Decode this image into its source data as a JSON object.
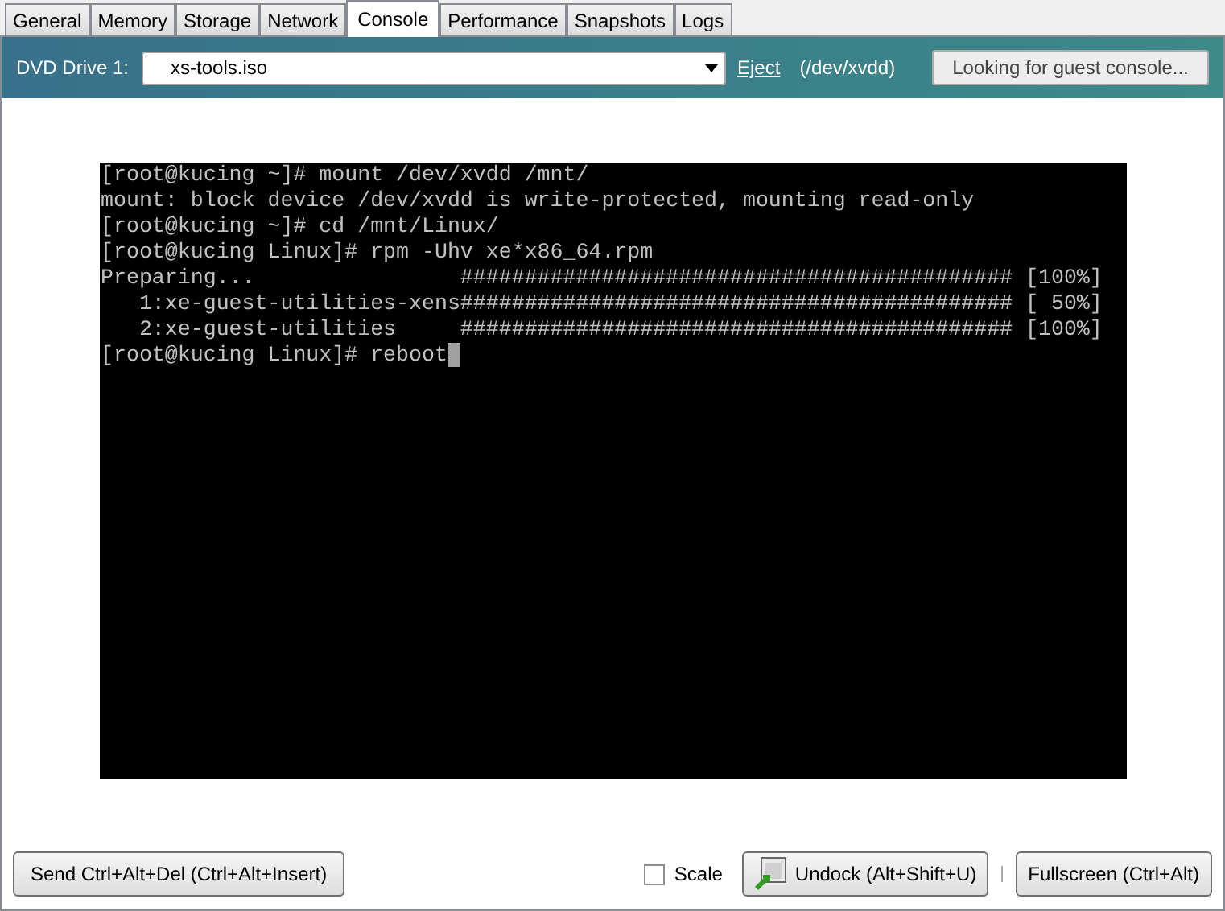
{
  "tabs": [
    {
      "label": "General",
      "selected": false
    },
    {
      "label": "Memory",
      "selected": false
    },
    {
      "label": "Storage",
      "selected": false
    },
    {
      "label": "Network",
      "selected": false
    },
    {
      "label": "Console",
      "selected": true
    },
    {
      "label": "Performance",
      "selected": false
    },
    {
      "label": "Snapshots",
      "selected": false
    },
    {
      "label": "Logs",
      "selected": false
    }
  ],
  "dvd_bar": {
    "label": "DVD Drive 1:",
    "drive_value": "xs-tools.iso",
    "eject_link": "Eject",
    "device_path": "(/dev/xvdd)",
    "console_button": "Looking for guest console..."
  },
  "terminal": {
    "lines": [
      "[root@kucing ~]# mount /dev/xvdd /mnt/",
      "mount: block device /dev/xvdd is write-protected, mounting read-only",
      "[root@kucing ~]# cd /mnt/Linux/",
      "[root@kucing Linux]# rpm -Uhv xe*x86_64.rpm",
      "Preparing...                ########################################### [100%]",
      "   1:xe-guest-utilities-xens########################################### [ 50%]",
      "   2:xe-guest-utilities     ########################################### [100%]",
      "[root@kucing Linux]# reboot"
    ],
    "cursor": true
  },
  "bottom_bar": {
    "send_button": "Send Ctrl+Alt+Del (Ctrl+Alt+Insert)",
    "scale": {
      "label": "Scale",
      "checked": false
    },
    "undock_button": "Undock (Alt+Shift+U)",
    "fullscreen_button": "Fullscreen (Ctrl+Alt)"
  }
}
